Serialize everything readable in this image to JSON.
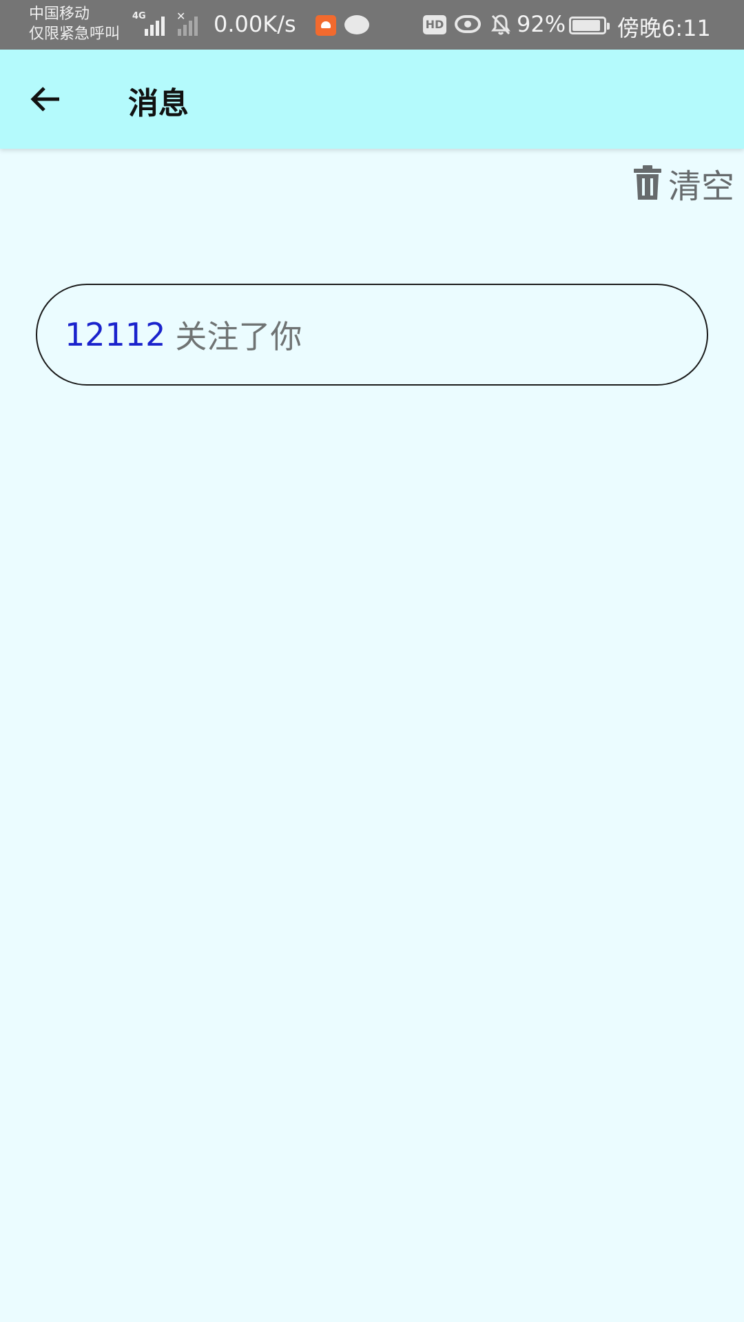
{
  "status_bar": {
    "carrier_line1": "中国移动",
    "carrier_line2": "仅限紧急呼叫",
    "network_type": "4G",
    "net_speed": "0.00K/s",
    "hd_label": "HD",
    "battery": "92%",
    "battery_level": 0.92,
    "time": "傍晚6:11",
    "icons": [
      "signal-icon",
      "no-signal-icon",
      "app-notification-icon",
      "chat-icon",
      "hd-icon",
      "eye-comfort-icon",
      "bell-muted-icon",
      "battery-icon"
    ]
  },
  "app_bar": {
    "back_icon": "arrow-left-icon",
    "title": "消息",
    "color": "#b4fafc"
  },
  "toolbar": {
    "clear_icon": "trash-icon",
    "clear_label": "清空"
  },
  "messages": [
    {
      "user": "12112",
      "text": "关注了你",
      "user_color": "#1a22cc"
    }
  ],
  "colors": {
    "background": "#ebfcff",
    "status_bar": "#757575"
  }
}
